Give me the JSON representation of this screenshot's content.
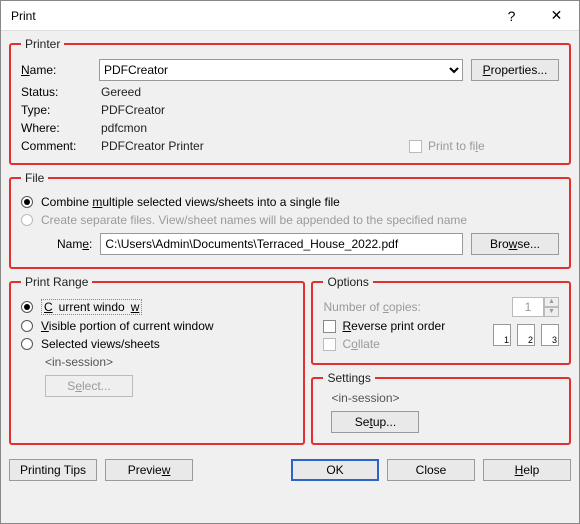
{
  "title": "Print",
  "help_icon": "?",
  "close_icon": "✕",
  "printer": {
    "legend": "Printer",
    "name_label": "Name:",
    "name_value": "PDFCreator",
    "properties_btn": "Properties...",
    "status_label": "Status:",
    "status_value": "Gereed",
    "type_label": "Type:",
    "type_value": "PDFCreator",
    "where_label": "Where:",
    "where_value": "pdfcmon",
    "comment_label": "Comment:",
    "comment_value": "PDFCreator Printer",
    "print_to_file": "Print to file"
  },
  "file": {
    "legend": "File",
    "opt_combine": "Combine multiple selected views/sheets into a single file",
    "opt_separate": "Create separate files. View/sheet names will be appended to the specified name",
    "name_label": "Name:",
    "name_value": "C:\\Users\\Admin\\Documents\\Terraced_House_2022.pdf",
    "browse_btn": "Browse..."
  },
  "range": {
    "legend": "Print Range",
    "opt_current": "Current window",
    "opt_visible": "Visible portion of current window",
    "opt_selected": "Selected views/sheets",
    "in_session": "<in-session>",
    "select_btn": "Select..."
  },
  "options": {
    "legend": "Options",
    "copies_label": "Number of copies:",
    "copies_value": "1",
    "reverse": "Reverse print order",
    "collate": "Collate"
  },
  "settings": {
    "legend": "Settings",
    "in_session": "<in-session>",
    "setup_btn": "Setup..."
  },
  "footer": {
    "tips": "Printing Tips",
    "preview": "Preview",
    "ok": "OK",
    "close": "Close",
    "help": "Help"
  }
}
